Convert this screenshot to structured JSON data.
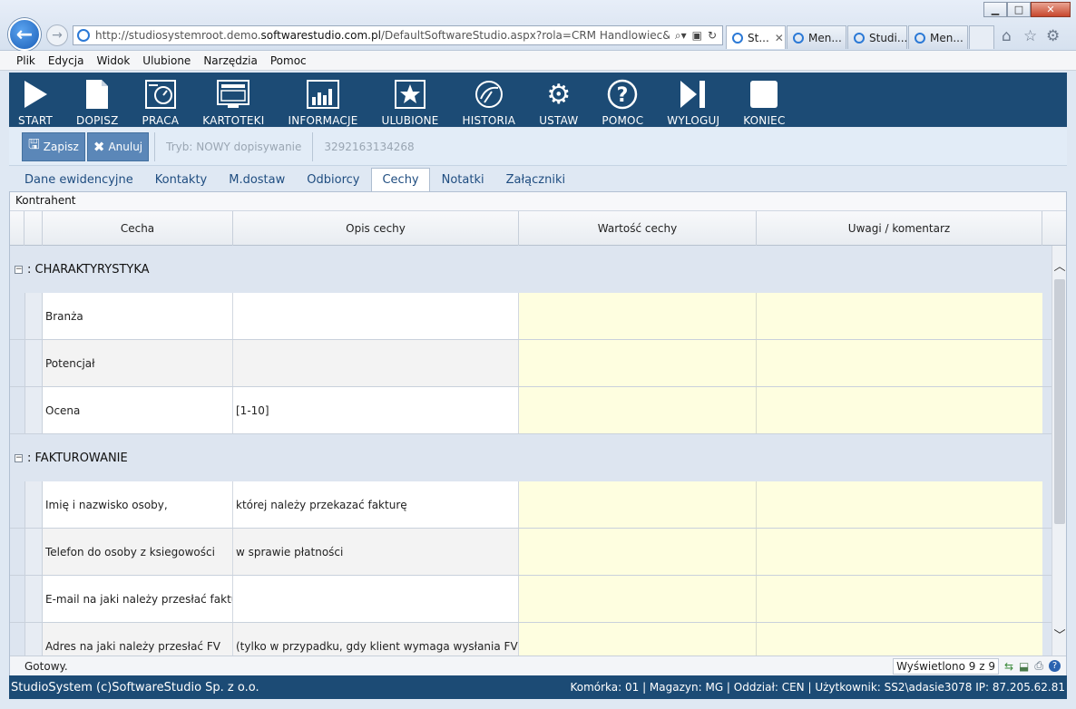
{
  "browser": {
    "url_prefix": "http://studiosystemroot.demo.",
    "url_domain": "softwarestudio.com.pl",
    "url_suffix": "/DefaultSoftwareStudio.aspx?rola=CRM Handlowiec&rolasys=CF",
    "tabs": [
      {
        "label": "St...",
        "active": true
      },
      {
        "label": "Men..."
      },
      {
        "label": "Studi..."
      },
      {
        "label": "Men..."
      }
    ],
    "window_controls": {
      "minimize": "▁",
      "maximize": "□",
      "close": "✕"
    }
  },
  "menu": {
    "items": [
      "Plik",
      "Edycja",
      "Widok",
      "Ulubione",
      "Narzędzia",
      "Pomoc"
    ]
  },
  "toolbar": {
    "buttons": [
      {
        "label": "START",
        "icon": "play-icon"
      },
      {
        "label": "DOPISZ",
        "icon": "new-document-icon"
      },
      {
        "label": "PRACA",
        "icon": "work-dial-icon"
      },
      {
        "label": "KARTOTEKI",
        "icon": "monitor-icon"
      },
      {
        "label": "INFORMACJE",
        "icon": "bar-chart-icon"
      },
      {
        "label": "ULUBIONE",
        "icon": "star-icon"
      },
      {
        "label": "HISTORIA",
        "icon": "history-icon"
      },
      {
        "label": "USTAW",
        "icon": "gears-icon"
      },
      {
        "label": "POMOC",
        "icon": "help-icon"
      },
      {
        "label": "WYLOGUJ",
        "icon": "logout-icon"
      },
      {
        "label": "KONIEC",
        "icon": "stop-icon"
      }
    ]
  },
  "actions": {
    "save_label": "Zapisz",
    "cancel_label": "Anuluj",
    "mode_text": "Tryb: NOWY dopisywanie",
    "record_id": "3292163134268"
  },
  "tabs": {
    "items": [
      "Dane ewidencyjne",
      "Kontakty",
      "M.dostaw",
      "Odbiorcy",
      "Cechy",
      "Notatki",
      "Załączniki"
    ],
    "active": "Cechy"
  },
  "section_title": "Kontrahent",
  "grid": {
    "columns": [
      "Cecha",
      "Opis cechy",
      "Wartość cechy",
      "Uwagi / komentarz"
    ],
    "groups": [
      {
        "title": ": CHARAKTYRYSTYKA",
        "rows": [
          {
            "cecha": "Branża",
            "opis": ""
          },
          {
            "cecha": "Potencjał",
            "opis": ""
          },
          {
            "cecha": "Ocena",
            "opis": "[1-10]"
          }
        ]
      },
      {
        "title": ": FAKTUROWANIE",
        "rows": [
          {
            "cecha": "Imię i nazwisko osoby,",
            "opis": "której należy przekazać fakturę"
          },
          {
            "cecha": "Telefon do osoby z ksiegowości",
            "opis": "w sprawie płatności"
          },
          {
            "cecha": "E-mail na jaki należy przesłać faktur",
            "opis": ""
          },
          {
            "cecha": "Adres na jaki należy przesłać FV",
            "opis": "(tylko w przypadku, gdy klient wymaga wysłania FV po"
          }
        ]
      }
    ]
  },
  "status": {
    "text": "Gotowy.",
    "count": "Wyświetlono 9 z 9"
  },
  "footer": {
    "copyright": "StudioSystem (c)SoftwareStudio Sp. z o.o.",
    "info": "Komórka: 01 | Magazyn: MG | Oddział: CEN | Użytkownik: SS2\\adasie3078 IP: 87.205.62.81"
  },
  "colors": {
    "toolbar_bg": "#1c4b75",
    "accent": "#5b87b8",
    "value_cell_bg": "#fefee0"
  }
}
